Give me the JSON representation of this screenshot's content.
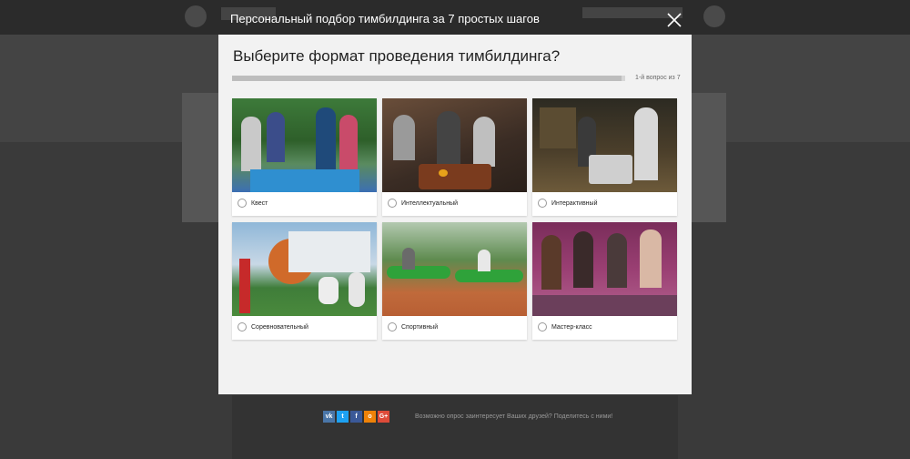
{
  "modal": {
    "title": "Персональный подбор тимбилдинга за 7 простых шагов",
    "question": "Выберите формат проведения тимбилдинга?",
    "progress_label": "1-й вопрос из 7",
    "progress_fraction": 0.99
  },
  "options": [
    {
      "label": "Квест",
      "selected": false
    },
    {
      "label": "Интеллектуальный",
      "selected": false
    },
    {
      "label": "Интерактивный",
      "selected": false
    },
    {
      "label": "Соревновательный",
      "selected": false
    },
    {
      "label": "Спортивный",
      "selected": false
    },
    {
      "label": "Мастер-класс",
      "selected": false
    }
  ],
  "share": {
    "buttons": [
      {
        "name": "vk",
        "glyph": "vk",
        "color": "#4a76a8"
      },
      {
        "name": "twitter",
        "glyph": "t",
        "color": "#1da1f2"
      },
      {
        "name": "facebook",
        "glyph": "f",
        "color": "#3b5998"
      },
      {
        "name": "odnoklassniki",
        "glyph": "o",
        "color": "#ee8208"
      },
      {
        "name": "google-plus",
        "glyph": "G+",
        "color": "#dd4b39"
      }
    ],
    "text": "Возможно опрос заинтересует Ваших друзей? Поделитесь с ними!"
  },
  "icons": {
    "close": "close-icon",
    "radio": "radio-icon"
  }
}
